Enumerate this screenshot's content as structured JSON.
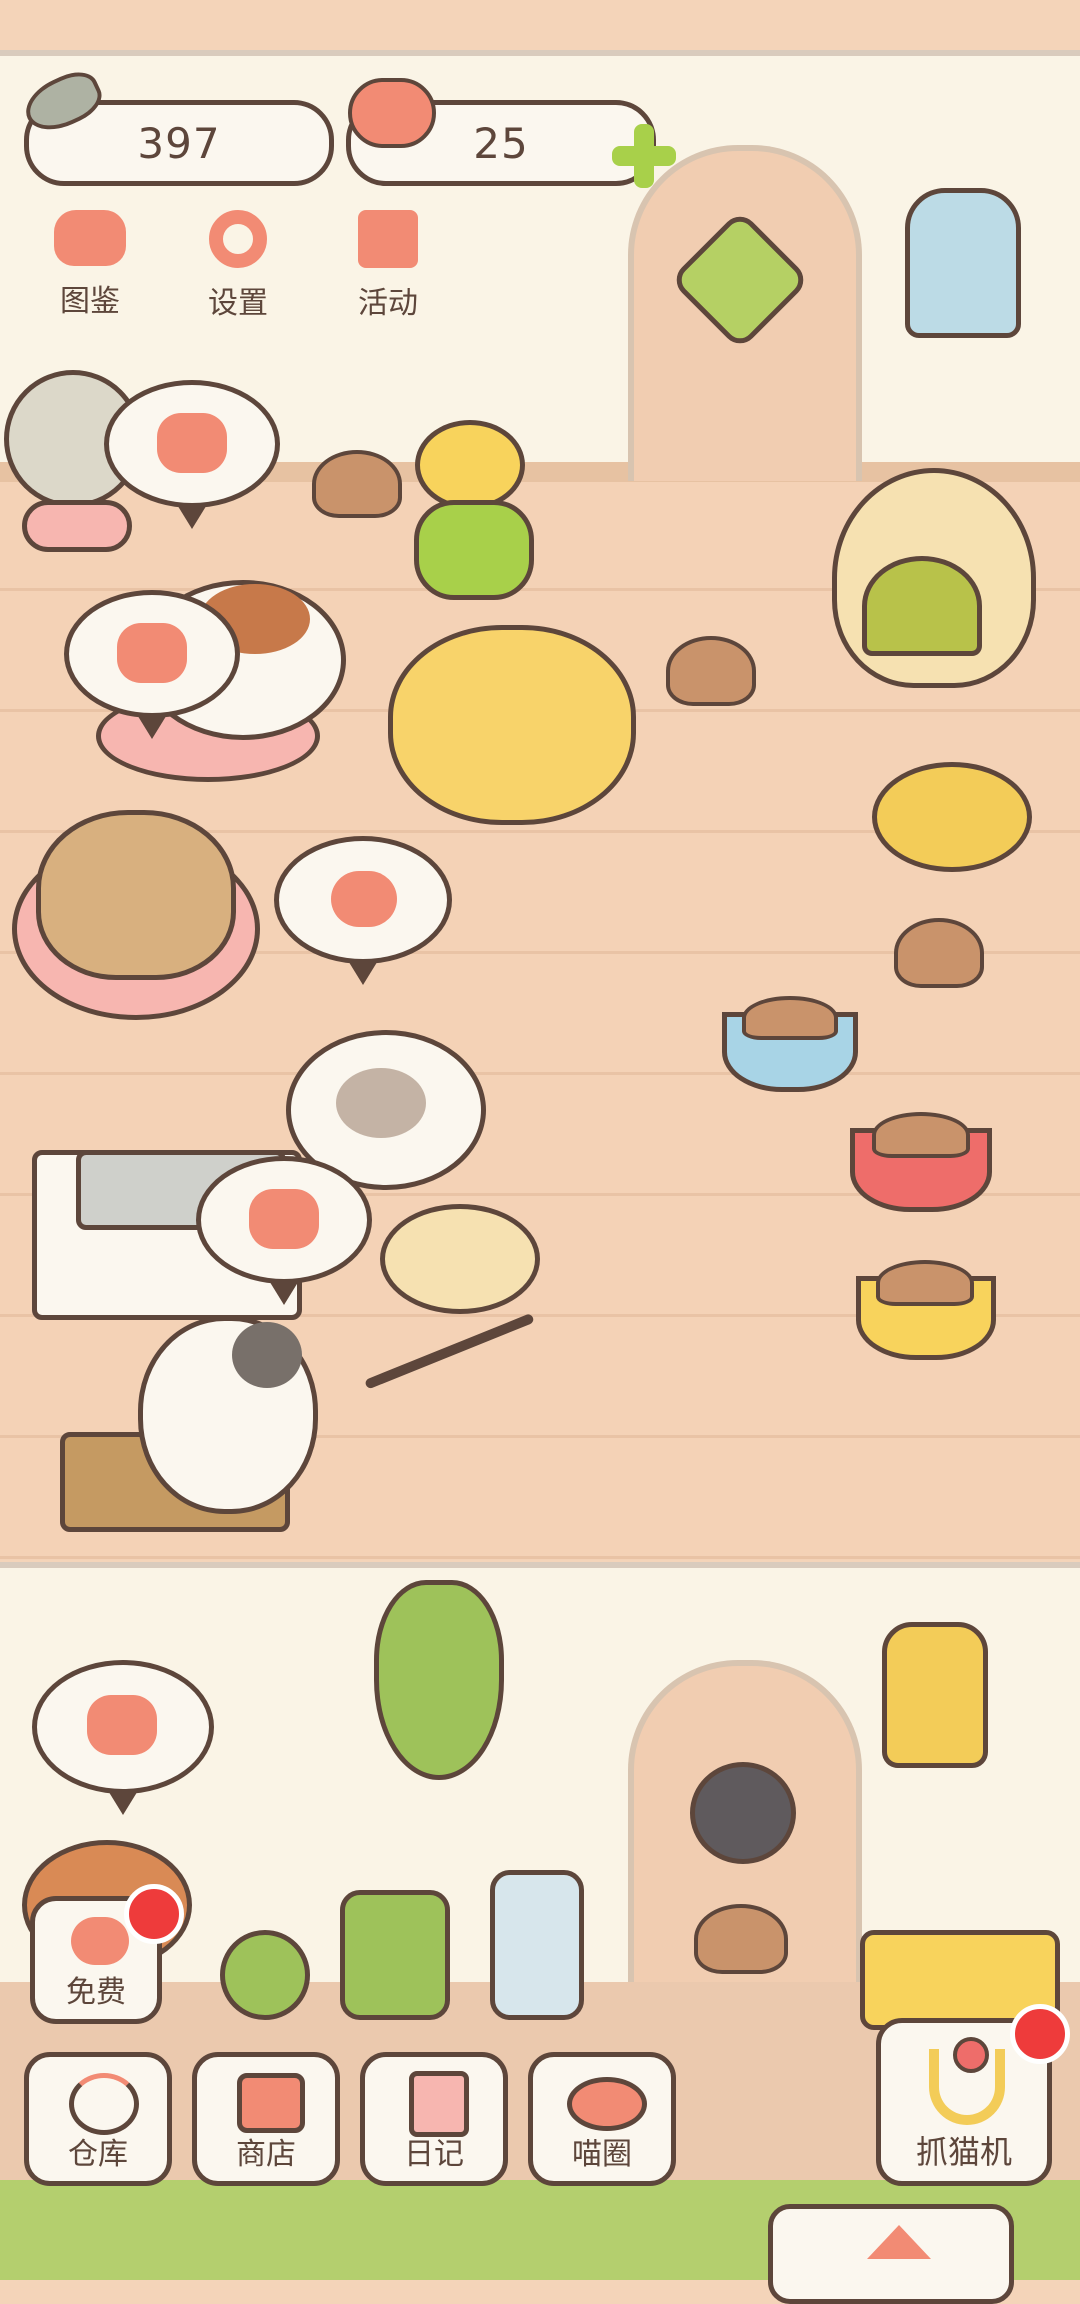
{
  "currency": {
    "fish_count": "397",
    "heart_count": "25",
    "add_icon": "plus-icon"
  },
  "top_menu": [
    {
      "label": "图鉴",
      "icon": "cat-book-icon"
    },
    {
      "label": "设置",
      "icon": "gear-icon"
    },
    {
      "label": "活动",
      "icon": "gift-icon"
    }
  ],
  "free_button": {
    "label": "免费",
    "icon": "heart-icon"
  },
  "bottom_nav": [
    {
      "label": "仓库",
      "icon": "storage-icon"
    },
    {
      "label": "商店",
      "icon": "shop-icon"
    },
    {
      "label": "日记",
      "icon": "diary-icon"
    },
    {
      "label": "喵圈",
      "icon": "planet-cat-icon"
    }
  ],
  "claw_button": {
    "label": "抓猫机",
    "icon": "claw-icon"
  },
  "colors": {
    "outline": "#5d463b",
    "floor": "#f4d2b6",
    "wall": "#faf4e6",
    "accent_coral": "#f28b74",
    "notify_red": "#ee3b3b",
    "plus_green": "#a8d04a"
  }
}
